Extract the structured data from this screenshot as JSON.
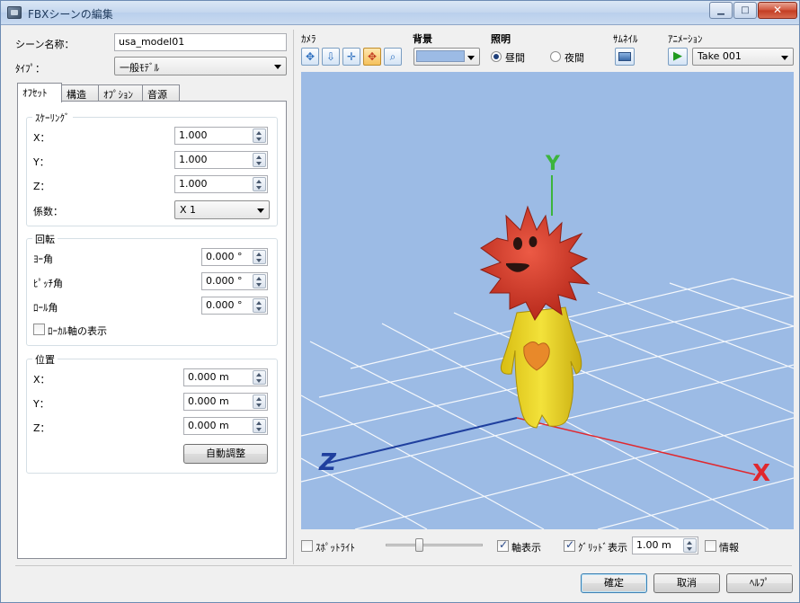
{
  "window": {
    "title": "FBXシーンの編集"
  },
  "scene": {
    "name_label": "シーン名称：",
    "name_value": "usa_model01",
    "type_label": "ﾀｲﾌﾟ：",
    "type_value": "一般ﾓﾃﾞﾙ"
  },
  "tabs": [
    "ｵﾌｾｯﾄ",
    "構造",
    "ｵﾌﾟｼｮﾝ",
    "音源"
  ],
  "scaling": {
    "title": "ｽｹｰﾘﾝｸﾞ",
    "x_label": "X：",
    "x_value": "1.000",
    "y_label": "Y：",
    "y_value": "1.000",
    "z_label": "Z：",
    "z_value": "1.000",
    "factor_label": "係数：",
    "factor_value": "X 1"
  },
  "rotation": {
    "title": "回転",
    "yaw_label": "ﾖｰ角",
    "yaw_value": "0.000 °",
    "pitch_label": "ﾋﾟｯﾁ角",
    "pitch_value": "0.000 °",
    "roll_label": "ﾛｰﾙ角",
    "roll_value": "0.000 °",
    "local_axis_label": "ﾛｰｶﾙ軸の表示"
  },
  "position": {
    "title": "位置",
    "x_label": "X：",
    "x_value": "0.000 m",
    "y_label": "Y：",
    "y_value": "0.000 m",
    "z_label": "Z：",
    "z_value": "0.000 m",
    "auto_adjust": "自動調整"
  },
  "viewer": {
    "camera_label": "ｶﾒﾗ",
    "background_label": "背景",
    "background_color": "#9cbbe5",
    "lighting_label": "照明",
    "day_label": "昼間",
    "night_label": "夜間",
    "thumbnail_label": "ｻﾑﾈｲﾙ",
    "animation_label": "ｱﾆﾒｰｼｮﾝ",
    "animation_value": "Take 001",
    "axis_y": "Y",
    "axis_z": "Z",
    "axis_x": "X"
  },
  "bottom": {
    "spotlight": "ｽﾎﾟｯﾄﾗｲﾄ",
    "axis_display": "軸表示",
    "grid_display": "ｸﾞﾘｯﾄﾞ表示",
    "grid_value": "1.00 m",
    "info": "情報"
  },
  "buttons": {
    "ok": "確定",
    "cancel": "取消",
    "help": "ﾍﾙﾌﾟ"
  },
  "colors": {
    "axis_x": "#e0282f",
    "axis_y": "#3cb43c",
    "axis_z": "#1f3f9e",
    "body": "#e6d21e",
    "head": "#d63a2a"
  }
}
